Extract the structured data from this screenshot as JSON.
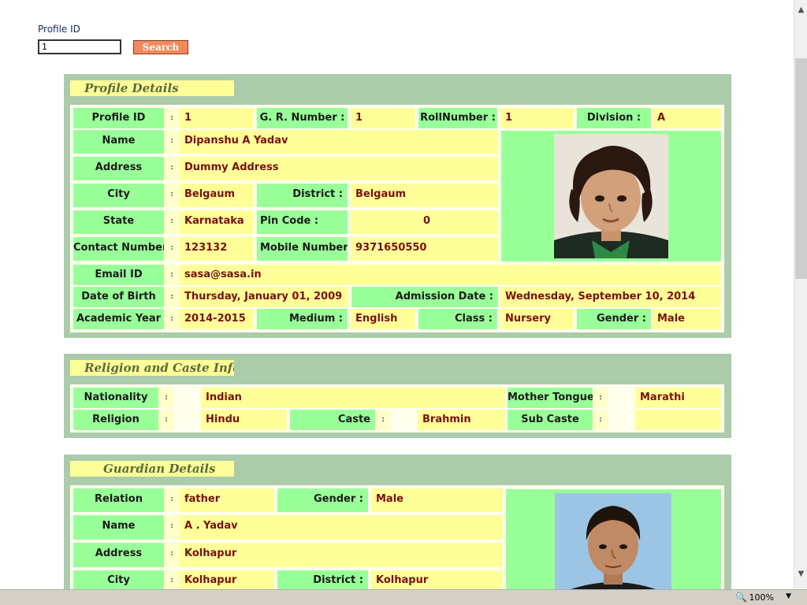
{
  "search": {
    "label": "Profile ID",
    "value": "1",
    "button": "Search"
  },
  "profile": {
    "title": "Profile Details",
    "sep": ":",
    "labels": {
      "profile_id": "Profile ID",
      "gr_number": "G. R. Number :",
      "roll_number": "RollNumber :",
      "division": "Division :",
      "name": "Name",
      "address": "Address",
      "city": "City",
      "district": "District :",
      "state": "State",
      "pin_code": "Pin Code :",
      "contact_number": "Contact Number",
      "mobile_number": "Mobile Number :",
      "email": "Email ID",
      "dob": "Date of Birth",
      "admission_date": "Admission Date :",
      "academic_year": "Academic Year",
      "medium": "Medium :",
      "class": "Class :",
      "gender": "Gender :"
    },
    "values": {
      "profile_id": "1",
      "gr_number": "1",
      "roll_number": "1",
      "division": "A",
      "name": "Dipanshu A Yadav",
      "address": "Dummy Address",
      "city": "Belgaum",
      "district": "Belgaum",
      "state": "Karnataka",
      "pin_code": "0",
      "contact_number": "123132",
      "mobile_number": "9371650550",
      "email": "sasa@sasa.in",
      "dob": "Thursday, January 01, 2009",
      "admission_date": "Wednesday, September 10, 2014",
      "academic_year": "2014-2015",
      "medium": "English",
      "class": "Nursery",
      "gender": "Male"
    }
  },
  "religion": {
    "title": "Religion and Caste Info",
    "sep": ":",
    "labels": {
      "nationality": "Nationality",
      "mother_tongue": "Mother Tongue",
      "religion": "Religion",
      "caste": "Caste",
      "sub_caste": "Sub Caste"
    },
    "values": {
      "nationality": "Indian",
      "mother_tongue": "Marathi",
      "religion": "Hindu",
      "caste": "Brahmin",
      "sub_caste": ""
    }
  },
  "guardian": {
    "title": "Guardian Details",
    "sep": ":",
    "labels": {
      "relation": "Relation",
      "gender": "Gender :",
      "name": "Name",
      "address": "Address",
      "city": "City",
      "district": "District :"
    },
    "values": {
      "relation": "father",
      "gender": "Male",
      "name": "A . Yadav",
      "address": "Kolhapur",
      "city": "Kolhapur",
      "district": "Kolhapur"
    }
  },
  "statusbar": {
    "zoom": "100%"
  }
}
